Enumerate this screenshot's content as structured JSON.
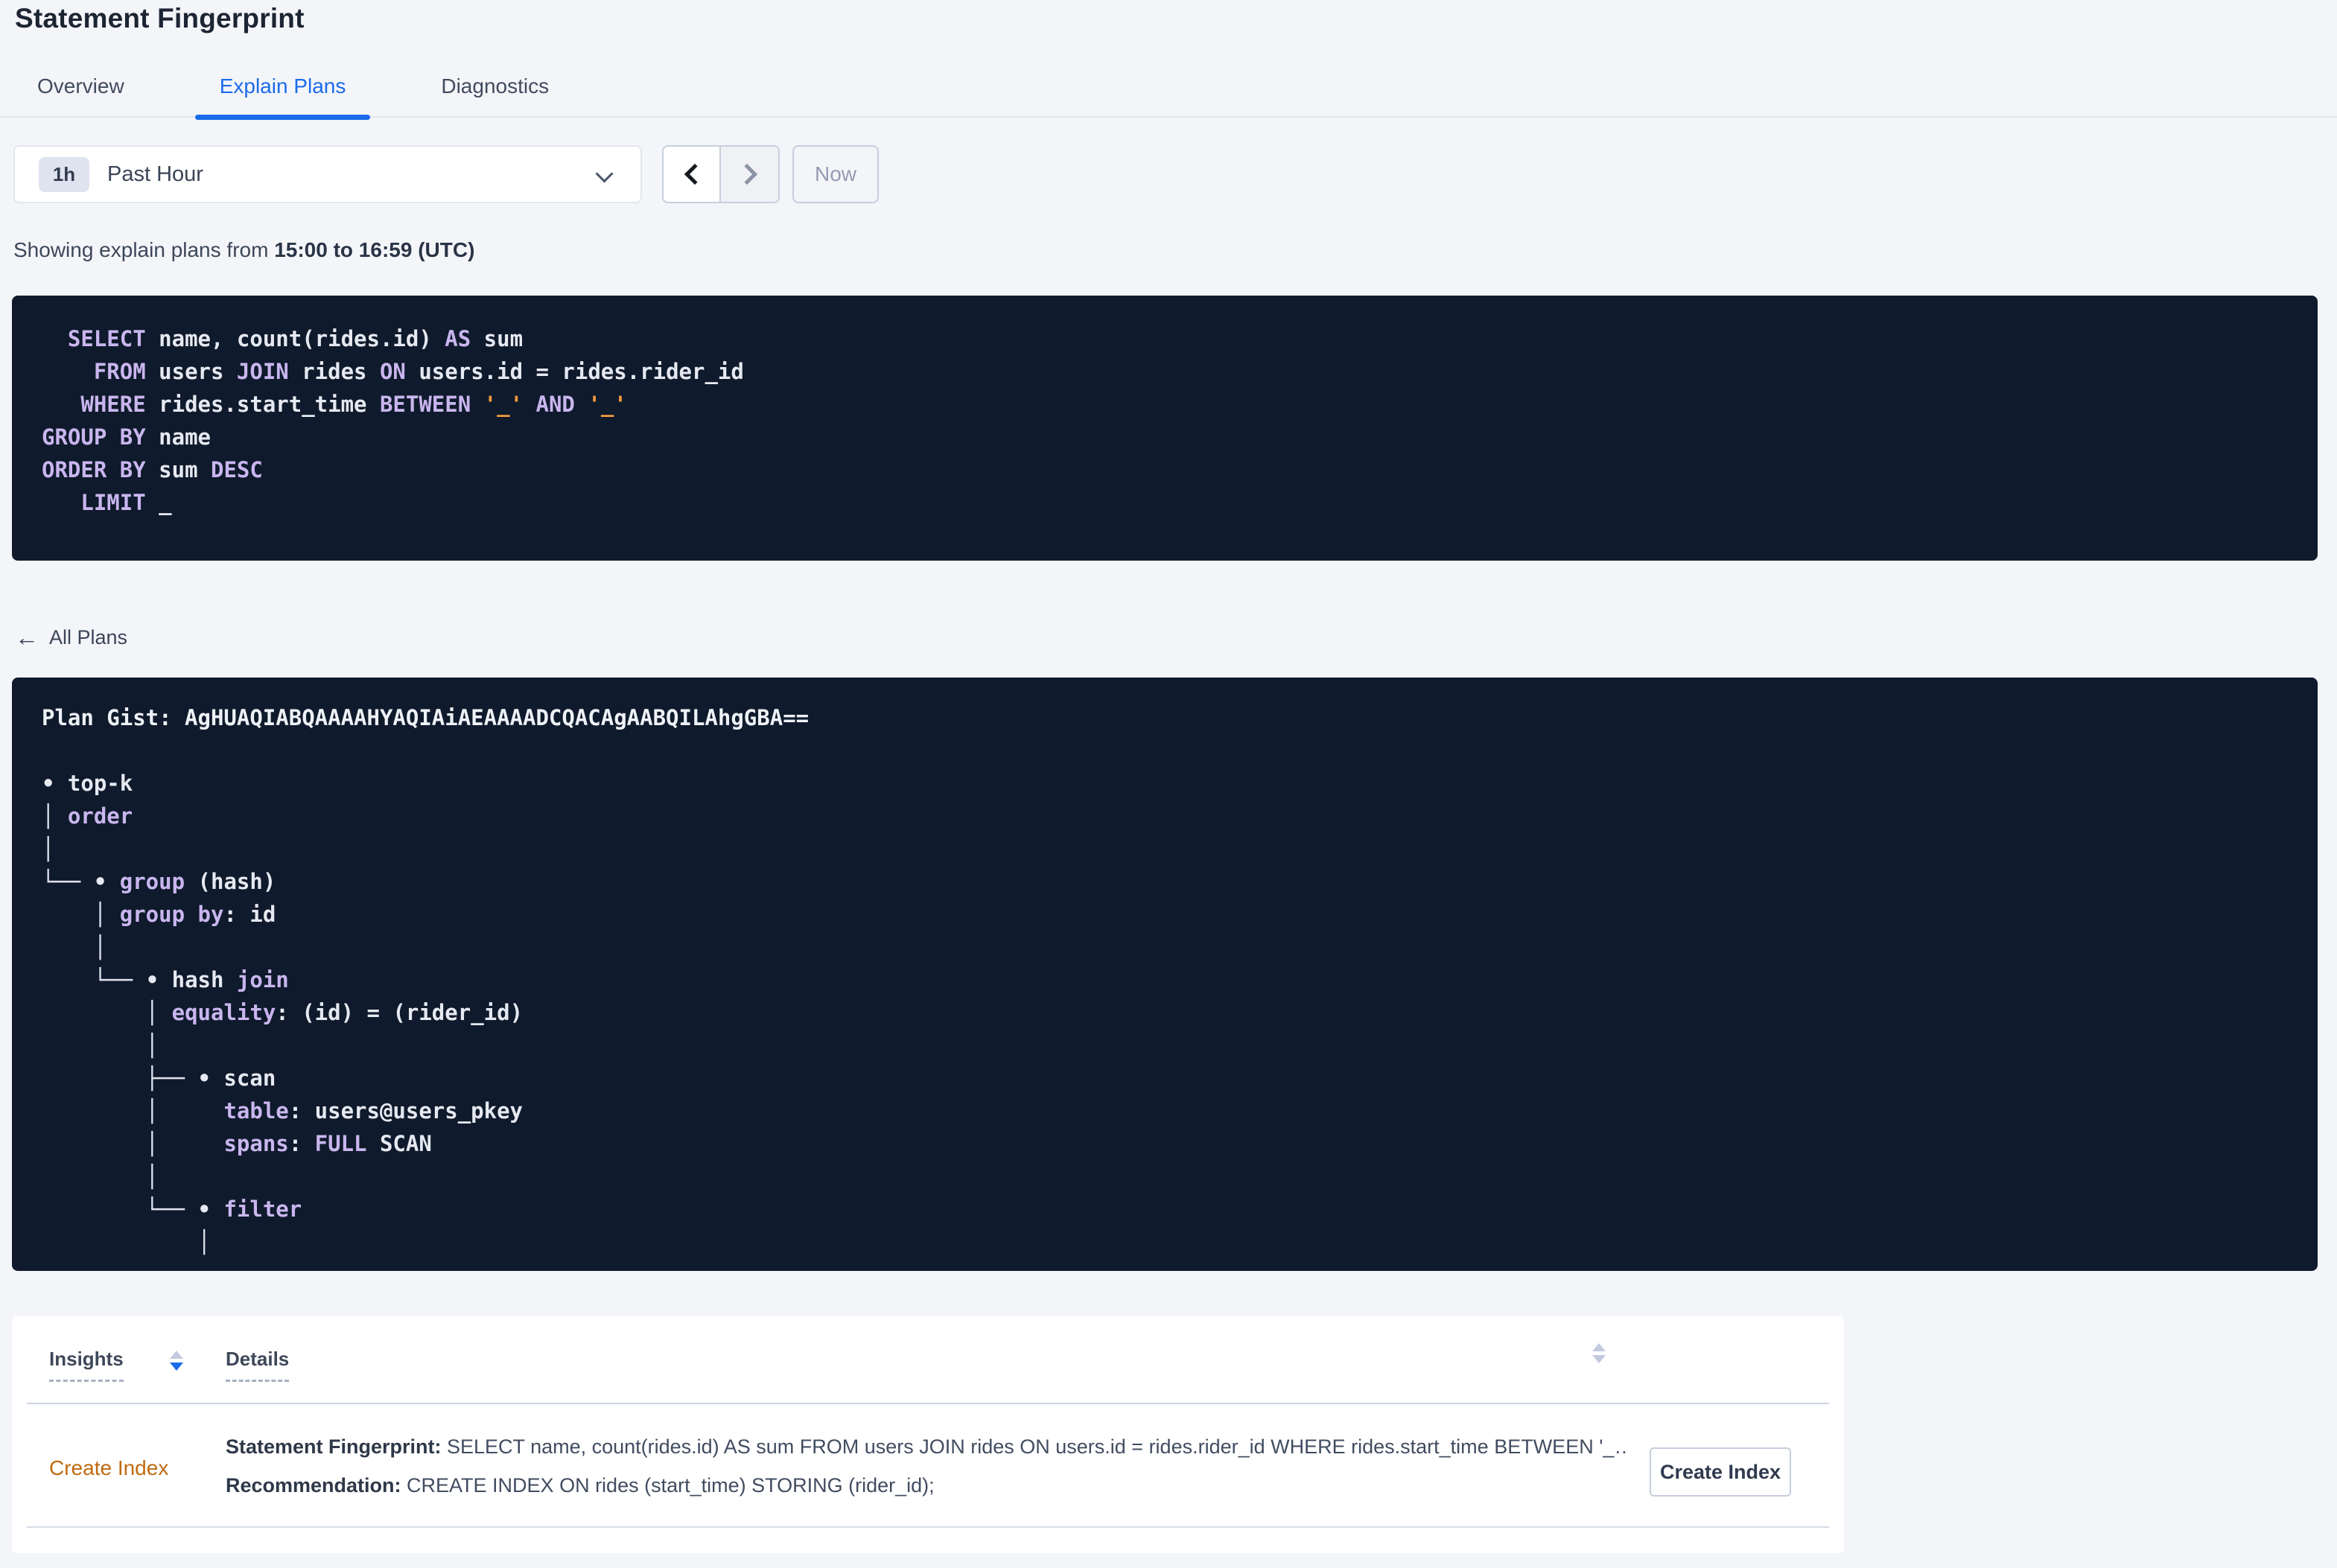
{
  "page_title": "Statement Fingerprint",
  "tabs": {
    "items": [
      {
        "label": "Overview",
        "active": false
      },
      {
        "label": "Explain Plans",
        "active": true
      },
      {
        "label": "Diagnostics",
        "active": false
      }
    ]
  },
  "time_controls": {
    "badge": "1h",
    "selected_range": "Past Hour",
    "now_button": "Now"
  },
  "summary": {
    "prefix": "Showing explain plans from ",
    "bold_range": "15:00 to 16:59 (UTC)"
  },
  "sql_statement": {
    "lines": [
      [
        [
          "kw",
          "  SELECT"
        ],
        [
          "id",
          " name, count(rides.id) "
        ],
        [
          "kw",
          "AS"
        ],
        [
          "id",
          " sum"
        ]
      ],
      [
        [
          "kw",
          "    FROM"
        ],
        [
          "id",
          " users "
        ],
        [
          "kw",
          "JOIN"
        ],
        [
          "id",
          " rides "
        ],
        [
          "kw",
          "ON"
        ],
        [
          "id",
          " users.id = rides.rider_id"
        ]
      ],
      [
        [
          "kw",
          "   WHERE"
        ],
        [
          "id",
          " rides.start_time "
        ],
        [
          "kw",
          "BETWEEN"
        ],
        [
          "id",
          " "
        ],
        [
          "lit",
          "'_'"
        ],
        [
          "id",
          " "
        ],
        [
          "kw",
          "AND"
        ],
        [
          "id",
          " "
        ],
        [
          "lit",
          "'_'"
        ]
      ],
      [
        [
          "kw",
          "GROUP BY"
        ],
        [
          "id",
          " name"
        ]
      ],
      [
        [
          "kw",
          "ORDER BY"
        ],
        [
          "id",
          " sum "
        ],
        [
          "kw",
          "DESC"
        ]
      ],
      [
        [
          "kw",
          "   LIMIT"
        ],
        [
          "id",
          " _"
        ]
      ]
    ]
  },
  "plans_nav": {
    "arrow": "←",
    "back_label": "All Plans"
  },
  "plan_gist_block": {
    "lines": [
      [
        [
          "b",
          "Plan Gist: AgHUAQIABQAAAAHYAQIAiAEAAAADCQACAgAABQILAhgGBA=="
        ]
      ],
      [],
      [
        [
          "id",
          "• top-k"
        ]
      ],
      [
        [
          "ln",
          "│ "
        ],
        [
          "kw",
          "order"
        ]
      ],
      [
        [
          "ln",
          "│"
        ]
      ],
      [
        [
          "ln",
          "└── "
        ],
        [
          "id",
          "• "
        ],
        [
          "kw",
          "group"
        ],
        [
          "id",
          " (hash)"
        ]
      ],
      [
        [
          "ln",
          "    │ "
        ],
        [
          "kw",
          "group by"
        ],
        [
          "id",
          ": id"
        ]
      ],
      [
        [
          "ln",
          "    │"
        ]
      ],
      [
        [
          "ln",
          "    └── "
        ],
        [
          "id",
          "• hash "
        ],
        [
          "kw",
          "join"
        ]
      ],
      [
        [
          "ln",
          "        │ "
        ],
        [
          "kw",
          "equality"
        ],
        [
          "id",
          ": (id) = (rider_id)"
        ]
      ],
      [
        [
          "ln",
          "        │"
        ]
      ],
      [
        [
          "ln",
          "        ├── "
        ],
        [
          "id",
          "• scan"
        ]
      ],
      [
        [
          "ln",
          "        │     "
        ],
        [
          "kw",
          "table"
        ],
        [
          "id",
          ": users@users_pkey"
        ]
      ],
      [
        [
          "ln",
          "        │     "
        ],
        [
          "kw",
          "spans"
        ],
        [
          "id",
          ": "
        ],
        [
          "kw",
          "FULL"
        ],
        [
          "id",
          " SCAN"
        ]
      ],
      [
        [
          "ln",
          "        │"
        ]
      ],
      [
        [
          "ln",
          "        └── "
        ],
        [
          "id",
          "• "
        ],
        [
          "kw",
          "filter"
        ]
      ],
      [
        [
          "ln",
          "            │"
        ]
      ]
    ]
  },
  "insights_table": {
    "insights_header": "Insights",
    "details_header": "Details",
    "row": {
      "insight_type": "Create Index",
      "fingerprint_label": "Statement Fingerprint:",
      "fingerprint_text": " SELECT name, count(rides.id) AS sum FROM users JOIN rides ON users.id = rides.rider_id WHERE rides.start_time BETWEEN '_…",
      "recommendation_label": "Recommendation:",
      "recommendation_text": " CREATE INDEX ON rides (start_time) STORING (rider_id);",
      "action_button": "Create Index"
    }
  },
  "colors": {
    "accent_blue": "#1a6beb",
    "code_background": "#0f1a2c",
    "keyword_lavender": "#c9b6ee",
    "literal_orange": "#f29a3e",
    "insight_link_orange": "#bf6a10",
    "page_background": "#f4f5f9"
  }
}
